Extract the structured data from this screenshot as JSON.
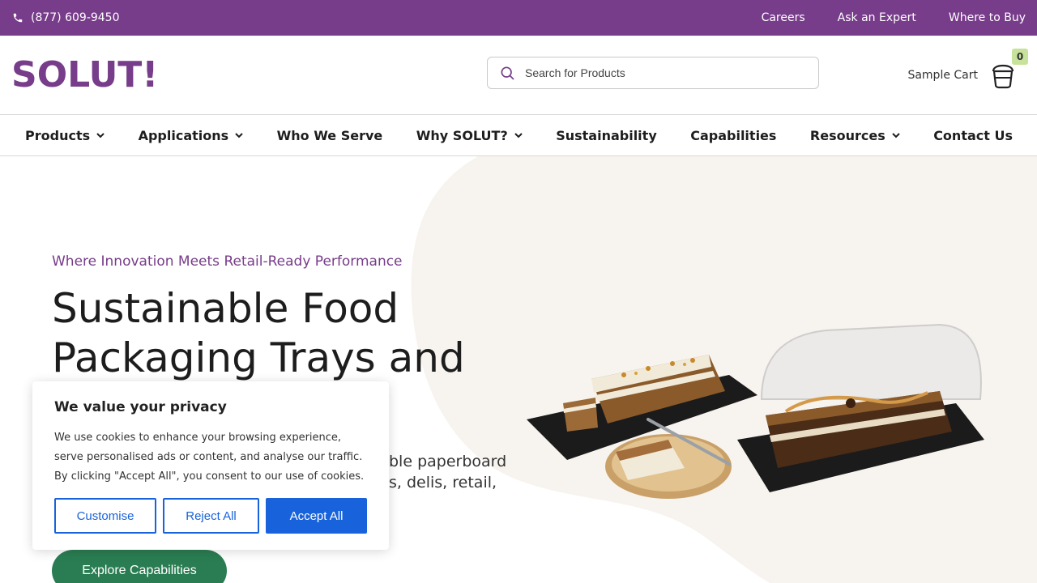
{
  "topbar": {
    "phone": "(877) 609-9450",
    "links": [
      "Careers",
      "Ask an Expert",
      "Where to Buy"
    ]
  },
  "header": {
    "logo": "SOLUT!",
    "search_placeholder": "Search for Products",
    "cart_label": "Sample Cart",
    "cart_count": "0"
  },
  "nav": {
    "items": [
      {
        "label": "Products",
        "dropdown": true
      },
      {
        "label": "Applications",
        "dropdown": true
      },
      {
        "label": "Who We Serve",
        "dropdown": false
      },
      {
        "label": "Why SOLUT?",
        "dropdown": true
      },
      {
        "label": "Sustainability",
        "dropdown": false
      },
      {
        "label": "Capabilities",
        "dropdown": false
      },
      {
        "label": "Resources",
        "dropdown": true
      },
      {
        "label": "Contact Us",
        "dropdown": false
      }
    ]
  },
  "hero": {
    "eyebrow": "Where Innovation Meets Retail-Ready Performance",
    "headline": "Sustainable Food Packaging Trays and",
    "body_visible": "ble paperboard s, delis, retail,",
    "body_line1": "ble paperboard",
    "body_line2": "s, delis, retail,",
    "cta": "Explore Capabilities"
  },
  "cookie": {
    "title": "We value your privacy",
    "text": "We use cookies to enhance your browsing experience, serve personalised ads or content, and analyse our traffic. By clicking \"Accept All\", you consent to our use of cookies.",
    "customise": "Customise",
    "reject": "Reject All",
    "accept": "Accept All"
  },
  "colors": {
    "brand_purple": "#773c8a",
    "cta_green": "#2a7d52",
    "cookie_blue": "#1863dc",
    "badge_green": "#c7e29a",
    "hero_bg": "#f7f3ef"
  }
}
